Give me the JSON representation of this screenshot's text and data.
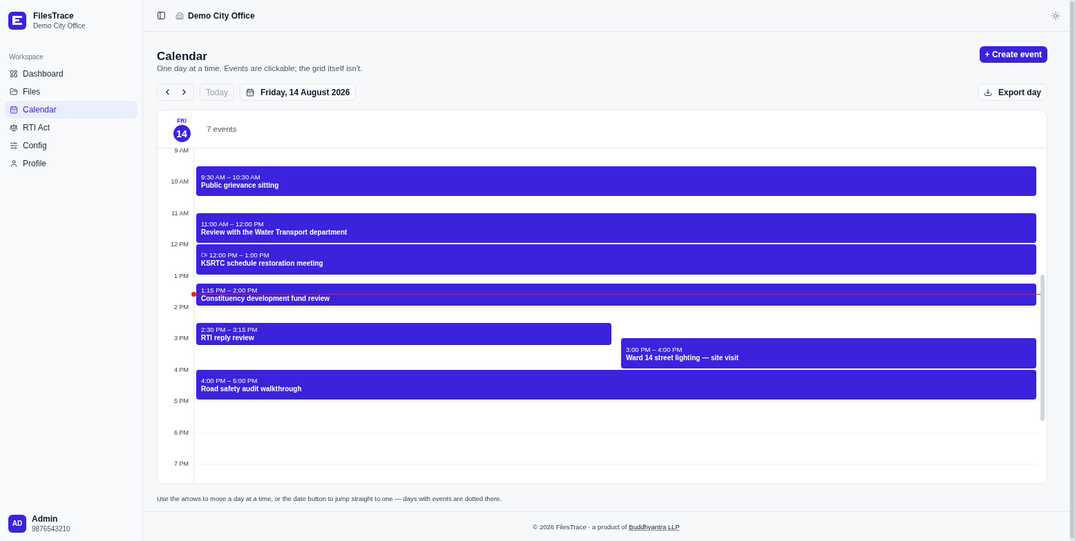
{
  "sidebar": {
    "app_name": "FilesTrace",
    "org": "Demo City Office",
    "section": "Workspace",
    "items": [
      {
        "label": "Dashboard",
        "selected": false
      },
      {
        "label": "Files",
        "selected": false
      },
      {
        "label": "Calendar",
        "selected": true
      },
      {
        "label": "RTI Act",
        "selected": false
      },
      {
        "label": "Config",
        "selected": false
      },
      {
        "label": "Profile",
        "selected": false
      }
    ],
    "user": {
      "initials": "AD",
      "name": "Admin",
      "phone": "9876543210"
    }
  },
  "topbar": {
    "office": "Demo City Office"
  },
  "page": {
    "title": "Calendar",
    "subtitle": "One day at a time. Events are clickable; the grid itself isn't.",
    "create_button": "+ Create event",
    "today_button": "Today",
    "date_button": "Friday, 14 August 2026",
    "export_button": "Export day"
  },
  "day": {
    "weekday": "FRI",
    "date": "14",
    "count": "7 events"
  },
  "hours": [
    "9 AM",
    "10 AM",
    "11 AM",
    "12 PM",
    "1 PM",
    "2 PM",
    "3 PM",
    "4 PM",
    "5 PM",
    "6 PM",
    "7 PM"
  ],
  "events": [
    {
      "time": "9:30 AM – 10:30 AM",
      "title": "Public grievance sitting",
      "video_call": false
    },
    {
      "time": "11:00 AM – 12:00 PM",
      "title": "Review with the Water Transport department",
      "video_call": false
    },
    {
      "time": "12:00 PM – 1:00 PM",
      "title": "KSRTC schedule restoration meeting",
      "video_call": true
    },
    {
      "time": "1:15 PM – 2:00 PM",
      "title": "Constituency development fund review",
      "video_call": false
    },
    {
      "time": "2:30 PM – 3:15 PM",
      "title": "RTI reply review",
      "video_call": false
    },
    {
      "time": "3:00 PM – 4:00 PM",
      "title": "Ward 14 street lighting — site visit",
      "video_call": false
    },
    {
      "time": "4:00 PM – 5:00 PM",
      "title": "Road safety audit walkthrough",
      "video_call": false
    }
  ],
  "hint": "Use the arrows to move a day at a time, or the date button to jump straight to one — days with events are dotted there.",
  "footer": {
    "text": "© 2026 FilesTrace · a product of",
    "link": "Buddhyantra LLP"
  }
}
